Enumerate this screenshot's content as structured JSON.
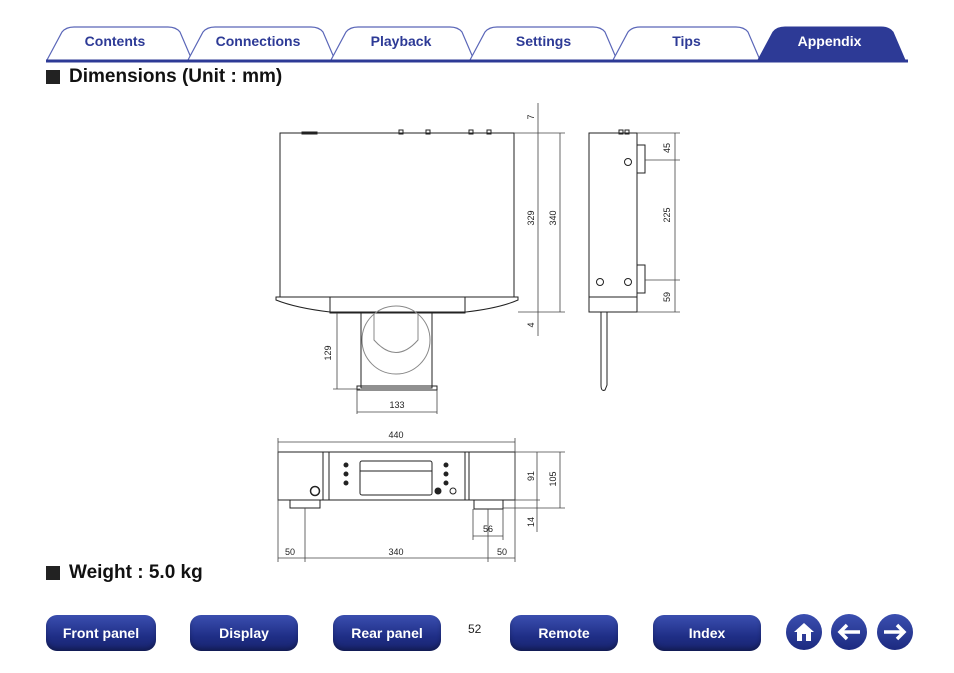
{
  "tabs": [
    {
      "label": "Contents",
      "active": false
    },
    {
      "label": "Connections",
      "active": false
    },
    {
      "label": "Playback",
      "active": false
    },
    {
      "label": "Settings",
      "active": false
    },
    {
      "label": "Tips",
      "active": false
    },
    {
      "label": "Appendix",
      "active": true
    }
  ],
  "colors": {
    "accent": "#2d3a96",
    "tab_border": "#5a66b8"
  },
  "sections": {
    "dimensions_title": "Dimensions (Unit : mm)",
    "weight_title": "Weight : 5.0 kg"
  },
  "dimensions": {
    "top_view": {
      "d7": "7",
      "d329": "329",
      "d340": "340",
      "d4": "4",
      "d129": "129",
      "d133": "133"
    },
    "side_view": {
      "d45": "45",
      "d225": "225",
      "d59": "59"
    },
    "front_view": {
      "d440": "440",
      "d91": "91",
      "d105": "105",
      "d14": "14",
      "d56": "56",
      "d50_left": "50",
      "d340": "340",
      "d50_right": "50"
    }
  },
  "footer": {
    "buttons": [
      "Front panel",
      "Display",
      "Rear panel",
      "Remote",
      "Index"
    ],
    "page_number": "52",
    "icons": [
      "home-icon",
      "arrow-left-icon",
      "arrow-right-icon"
    ]
  }
}
